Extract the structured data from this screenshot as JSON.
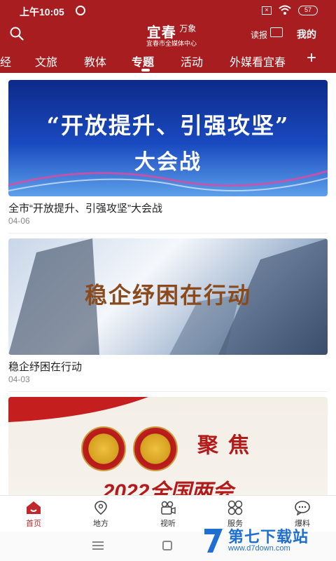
{
  "status_bar": {
    "time": "上午10:05",
    "battery": "57",
    "sim": "×"
  },
  "header": {
    "logo_main": "宜春",
    "logo_wan": "万象",
    "logo_sub": "宜春市全媒体中心",
    "read_label": "读报",
    "mine_label": "我的"
  },
  "tabs": [
    {
      "label": "经"
    },
    {
      "label": "文旅"
    },
    {
      "label": "教体"
    },
    {
      "label": "专题",
      "active": true
    },
    {
      "label": "活动"
    },
    {
      "label": "外媒看宜春"
    }
  ],
  "tabs_plus": "+",
  "articles": [
    {
      "banner_line1": "“开放提升、引强攻坚”",
      "banner_line2": "大会战",
      "title": "全市“开放提升、引强攻坚”大会战",
      "date": "04-06"
    },
    {
      "banner_text": "稳企纾困在行动",
      "title": "稳企纾困在行动",
      "date": "04-03"
    },
    {
      "banner_focus": "聚焦",
      "banner_bottom": "2022全国两会"
    }
  ],
  "bottom_nav": [
    {
      "label": "首页",
      "icon": "home-icon",
      "active": true
    },
    {
      "label": "地方",
      "icon": "location-icon"
    },
    {
      "label": "视听",
      "icon": "video-camera-icon"
    },
    {
      "label": "服务",
      "icon": "grid-flower-icon"
    },
    {
      "label": "爆料",
      "icon": "chat-bubble-icon"
    }
  ],
  "watermark": {
    "title": "第七下载站",
    "url": "www.d7down.com"
  },
  "colors": {
    "brand_red": "#a81d20",
    "active_nav": "#c0272d",
    "watermark_blue": "#1f6fd0"
  }
}
